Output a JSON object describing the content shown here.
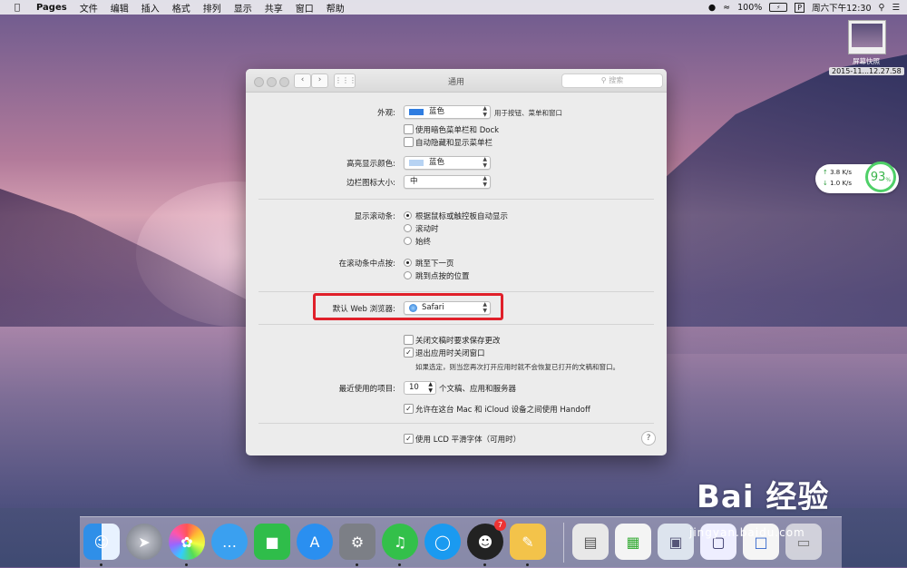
{
  "menubar": {
    "app_name": "Pages",
    "menus": [
      "文件",
      "编辑",
      "插入",
      "格式",
      "排列",
      "显示",
      "共享",
      "窗口",
      "帮助"
    ],
    "battery": "100%",
    "input_method": "P",
    "clock": "周六下午12:30"
  },
  "desktop": {
    "thumbnail_label": "屏幕快照",
    "thumbnail_date": "2015-11...12.27.58",
    "net_up": "3.8 K/s",
    "net_down": "1.0 K/s",
    "net_percent": "93",
    "net_percent_unit": "%"
  },
  "window": {
    "title": "通用",
    "search_placeholder": "搜索",
    "appearance": {
      "label": "外观:",
      "value": "蓝色",
      "swatch_color": "#2f7de1",
      "suffix": "用于按钮、菜单和窗口",
      "dark_menu_label": "使用暗色菜单栏和 Dock",
      "dark_menu_checked": false,
      "autohide_label": "自动隐藏和显示菜单栏",
      "autohide_checked": false
    },
    "highlight_color": {
      "label": "高亮显示颜色:",
      "value": "蓝色",
      "swatch_color": "#b7d3f3"
    },
    "sidebar_icon_size": {
      "label": "边栏图标大小:",
      "value": "中"
    },
    "show_scrollbars": {
      "label": "显示滚动条:",
      "options": [
        "根据鼠标或触控板自动显示",
        "滚动时",
        "始终"
      ],
      "selected_index": 0
    },
    "click_scrollbar": {
      "label": "在滚动条中点按:",
      "options": [
        "跳至下一页",
        "跳到点按的位置"
      ],
      "selected_index": 0
    },
    "default_browser": {
      "label": "默认 Web 浏览器:",
      "value": "Safari"
    },
    "close_docs": {
      "ask_save_label": "关闭文稿时要求保存更改",
      "ask_save_checked": false,
      "close_windows_label": "退出应用时关闭窗口",
      "close_windows_checked": true,
      "note": "如果选定，则当您再次打开应用时就不会恢复已打开的文稿和窗口。"
    },
    "recent_items": {
      "label": "最近使用的项目:",
      "value": "10",
      "suffix": "个文稿、应用和服务器"
    },
    "handoff": {
      "label": "允许在这台 Mac 和 iCloud 设备之间使用 Handoff",
      "checked": true
    },
    "lcd": {
      "label": "使用 LCD 平滑字体（可用时）",
      "checked": true
    },
    "help": "?"
  },
  "dock": {
    "qq_badge": "7",
    "icons": [
      "finder-icon",
      "launchpad-icon",
      "photos-icon",
      "messages-icon",
      "facetime-icon",
      "appstore-icon",
      "system-preferences-icon",
      "qqmusic-icon",
      "qqbrowser-icon",
      "qq-icon",
      "pages-icon",
      "preview-icon",
      "numbers-icon",
      "window-icon",
      "screenshot-icon",
      "trash-icon"
    ]
  },
  "watermark": {
    "text": "Bai 经验",
    "sub": "jingyan.baidu.com"
  },
  "colors": {
    "highlight_box": "#e0202a",
    "accent": "#2f7de1"
  }
}
